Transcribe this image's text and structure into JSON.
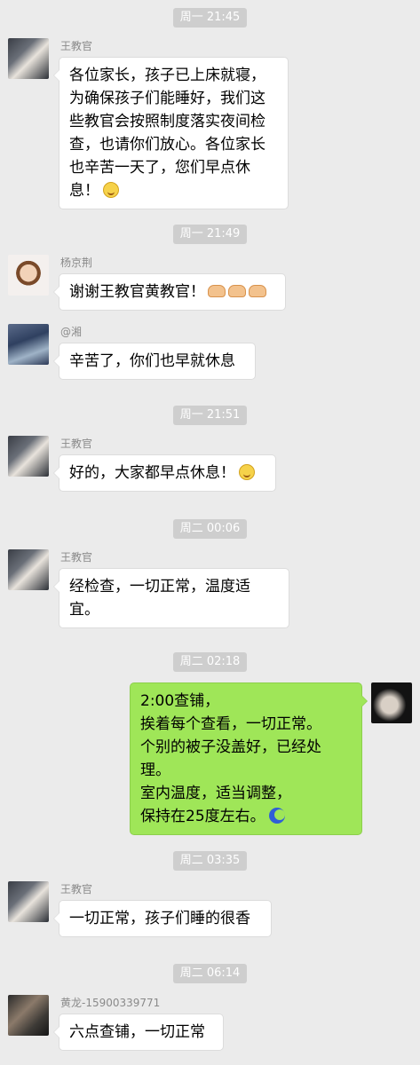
{
  "colors": {
    "background": "#ebebeb",
    "timestamp_bg": "#cecece",
    "incoming_bubble": "#ffffff",
    "outgoing_bubble": "#9fe658"
  },
  "messages": [
    {
      "time": "周一 21:45",
      "sender": "王教官",
      "lines": [
        "各位家长，孩子已上床就寝，",
        "为确保孩子们能睡好，我们这",
        "些教官会按照制度落实夜间检",
        "查，也请你们放心。各位家长",
        "也辛苦一天了，您们早点休",
        "息！"
      ],
      "trailing_icon": "smile-emoji-icon"
    },
    {
      "time": "周一 21:49",
      "sender": "杨京荆",
      "lines": [
        "谢谢王教官黄教官！"
      ],
      "trailing_icon": "clap-emoji-icon x3"
    },
    {
      "sender": "@湘",
      "lines": [
        "辛苦了，你们也早就休息"
      ]
    },
    {
      "time": "周一 21:51",
      "sender": "王教官",
      "lines": [
        "好的，大家都早点休息！"
      ],
      "trailing_icon": "smile-emoji-icon"
    },
    {
      "time": "周二 00:06",
      "sender": "王教官",
      "lines": [
        "经检查，一切正常，温度适",
        "宜。"
      ]
    },
    {
      "time": "周二 02:18",
      "lines": [
        "2:00查铺，",
        "挨着每个查看，一切正常。",
        "个别的被子没盖好，已经处",
        "理。",
        "室内温度，适当调整，",
        "保持在25度左右。"
      ],
      "trailing_icon": "moon-emoji-icon"
    },
    {
      "time": "周二 03:35",
      "sender": "王教官",
      "lines": [
        "一切正常，孩子们睡的很香"
      ]
    },
    {
      "time": "周二 06:14",
      "sender": "黄龙-15900339771",
      "lines": [
        "六点查铺，一切正常"
      ]
    }
  ]
}
